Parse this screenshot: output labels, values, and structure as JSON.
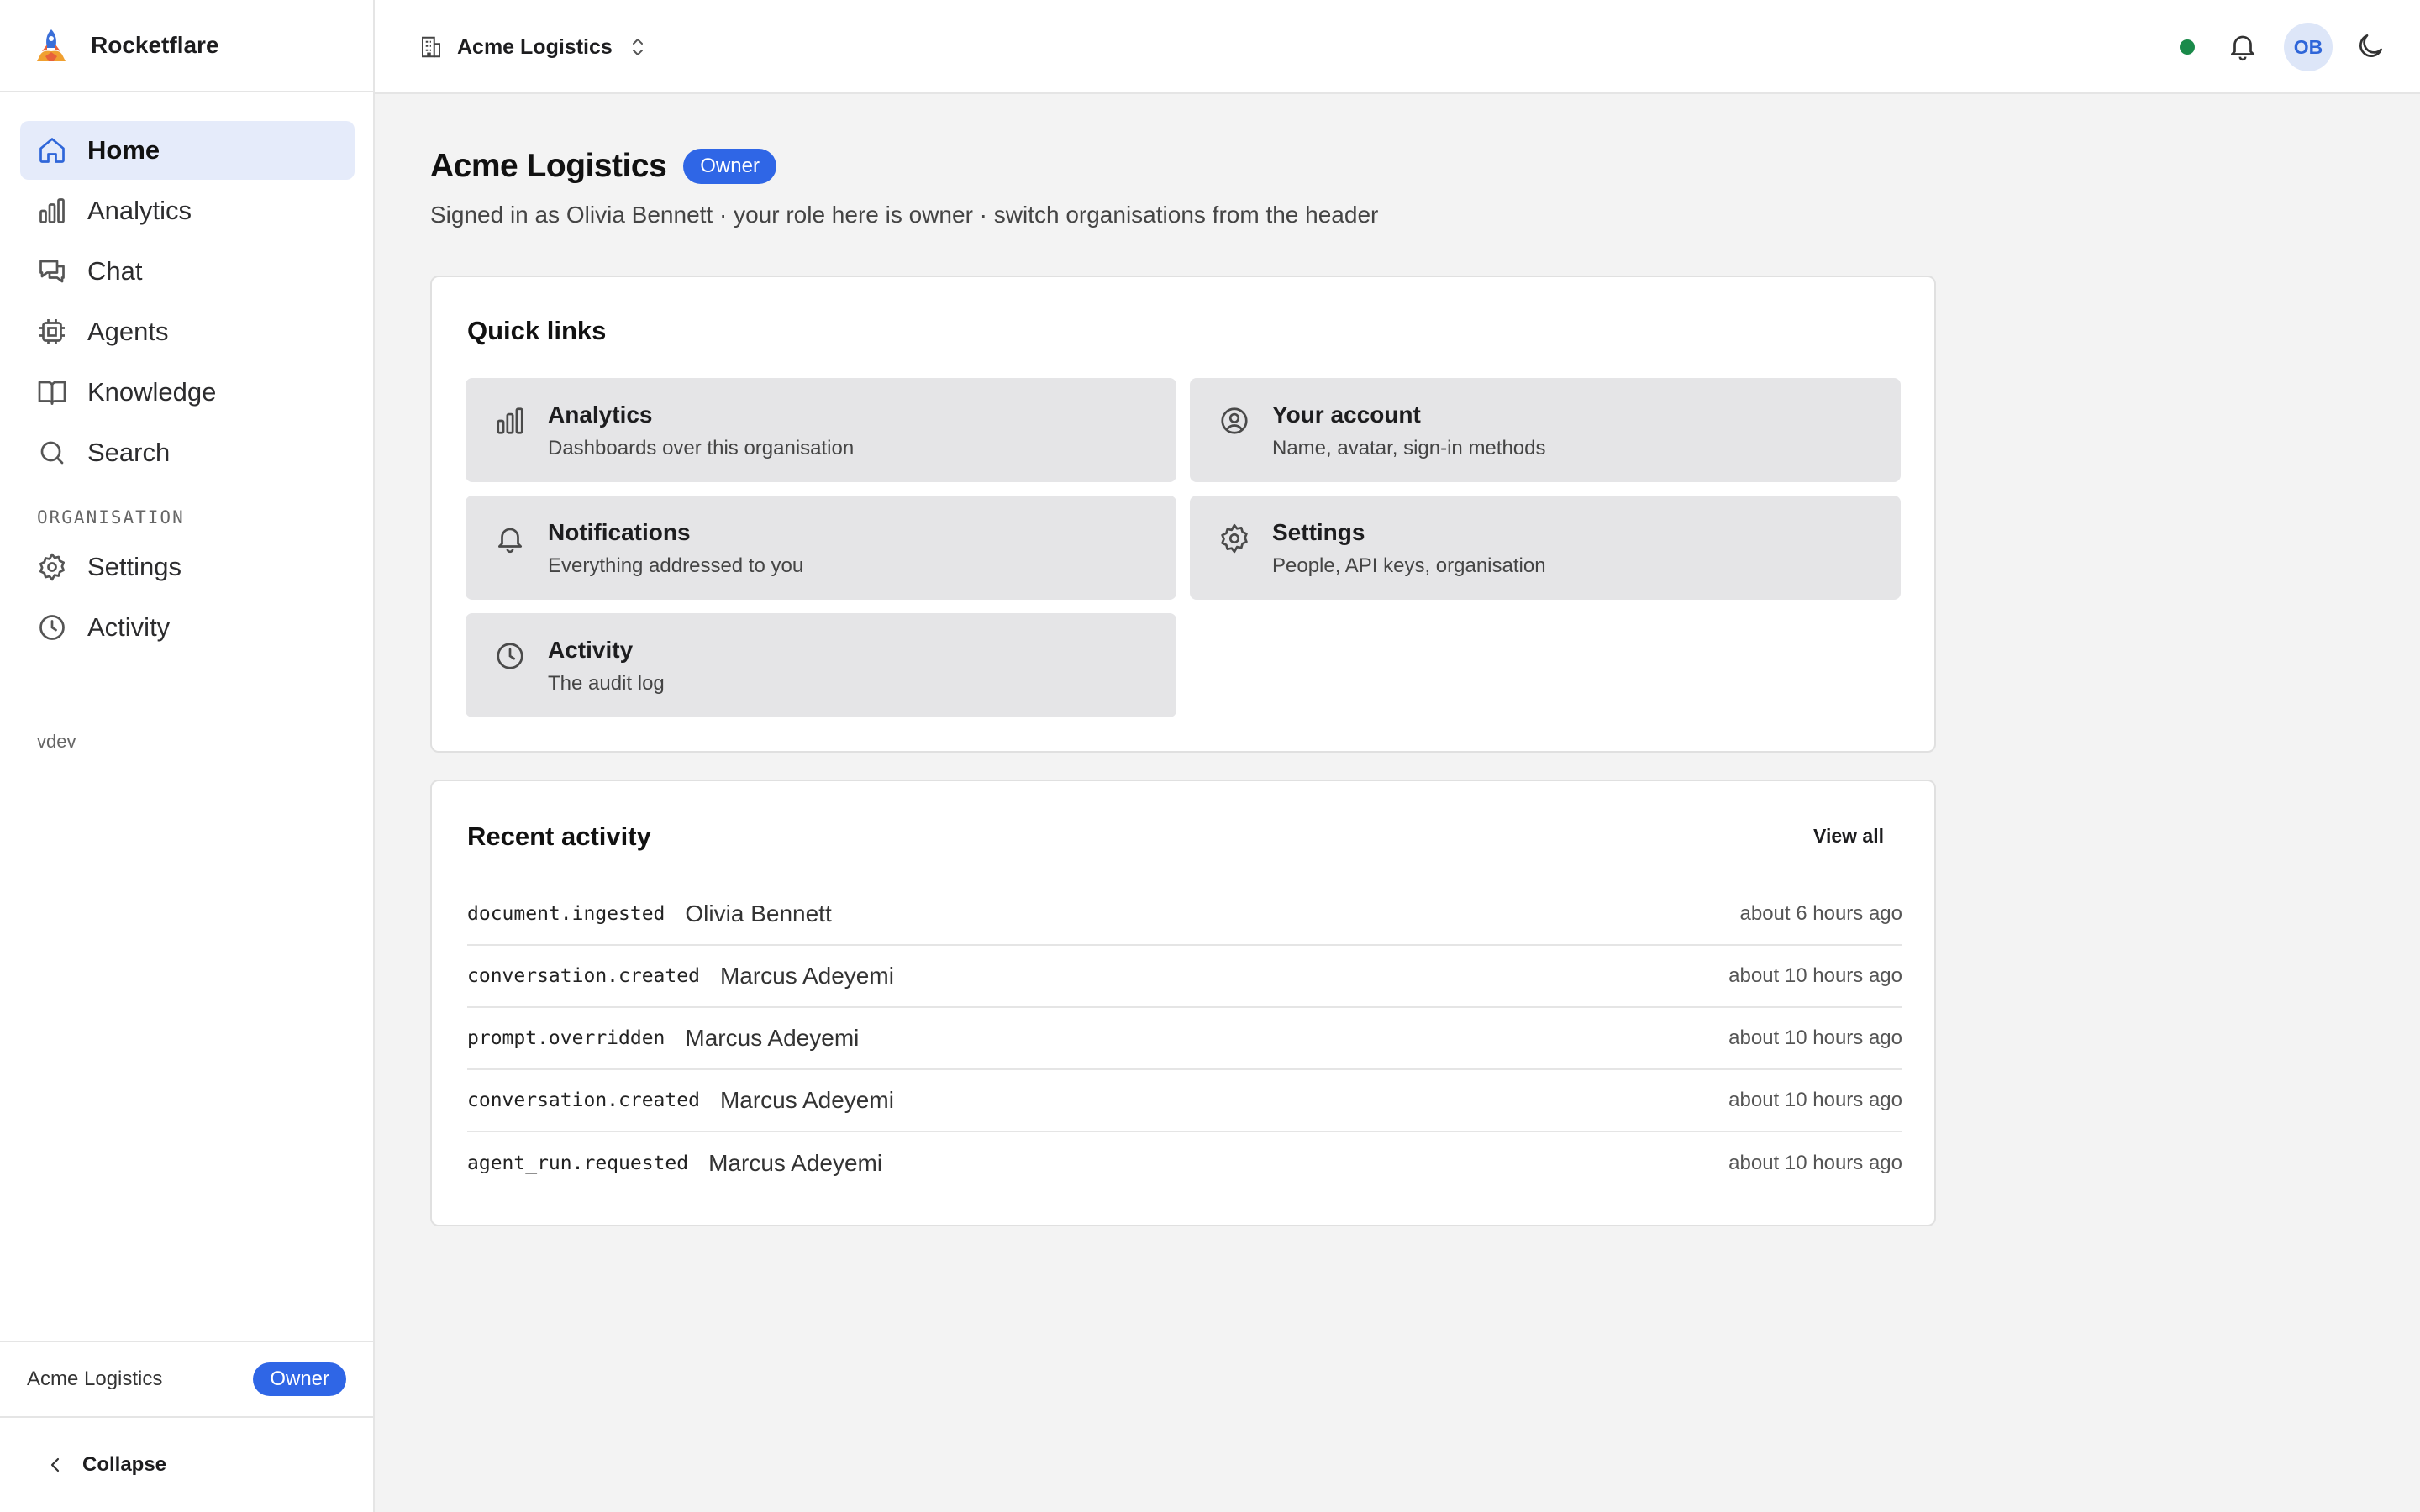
{
  "app": {
    "name": "Rocketflare"
  },
  "sidebar": {
    "nav": [
      {
        "label": "Home",
        "icon": "home-icon",
        "active": true
      },
      {
        "label": "Analytics",
        "icon": "bar-chart-icon"
      },
      {
        "label": "Chat",
        "icon": "chat-icon"
      },
      {
        "label": "Agents",
        "icon": "cpu-icon"
      },
      {
        "label": "Knowledge",
        "icon": "book-icon"
      },
      {
        "label": "Search",
        "icon": "search-icon"
      }
    ],
    "section_label": "ORGANISATION",
    "org_nav": [
      {
        "label": "Settings",
        "icon": "gear-icon"
      },
      {
        "label": "Activity",
        "icon": "clock-icon"
      }
    ],
    "version": "vdev",
    "footer": {
      "org_name": "Acme Logistics",
      "role_badge": "Owner"
    },
    "collapse_label": "Collapse"
  },
  "header": {
    "org_switcher": "Acme Logistics",
    "avatar_initials": "OB",
    "status_color": "#1a8a4a"
  },
  "page": {
    "title": "Acme Logistics",
    "role_badge": "Owner",
    "subtitle": "Signed in as Olivia Bennett · your role here is owner · switch organisations from the header"
  },
  "quick_links": {
    "title": "Quick links",
    "items": [
      {
        "title": "Analytics",
        "desc": "Dashboards over this organisation",
        "icon": "bar-chart-icon"
      },
      {
        "title": "Your account",
        "desc": "Name, avatar, sign-in methods",
        "icon": "user-circle-icon"
      },
      {
        "title": "Notifications",
        "desc": "Everything addressed to you",
        "icon": "bell-icon"
      },
      {
        "title": "Settings",
        "desc": "People, API keys, organisation",
        "icon": "gear-icon"
      },
      {
        "title": "Activity",
        "desc": "The audit log",
        "icon": "clock-icon"
      }
    ]
  },
  "recent_activity": {
    "title": "Recent activity",
    "view_all": "View all",
    "rows": [
      {
        "event": "document.ingested",
        "actor": "Olivia Bennett",
        "time": "about 6 hours ago"
      },
      {
        "event": "conversation.created",
        "actor": "Marcus Adeyemi",
        "time": "about 10 hours ago"
      },
      {
        "event": "prompt.overridden",
        "actor": "Marcus Adeyemi",
        "time": "about 10 hours ago"
      },
      {
        "event": "conversation.created",
        "actor": "Marcus Adeyemi",
        "time": "about 10 hours ago"
      },
      {
        "event": "agent_run.requested",
        "actor": "Marcus Adeyemi",
        "time": "about 10 hours ago"
      }
    ]
  },
  "colors": {
    "accent": "#2f66e6",
    "active_nav_bg": "#e5ebfa",
    "tile_bg": "#e5e5e7",
    "page_bg": "#f3f3f3"
  }
}
